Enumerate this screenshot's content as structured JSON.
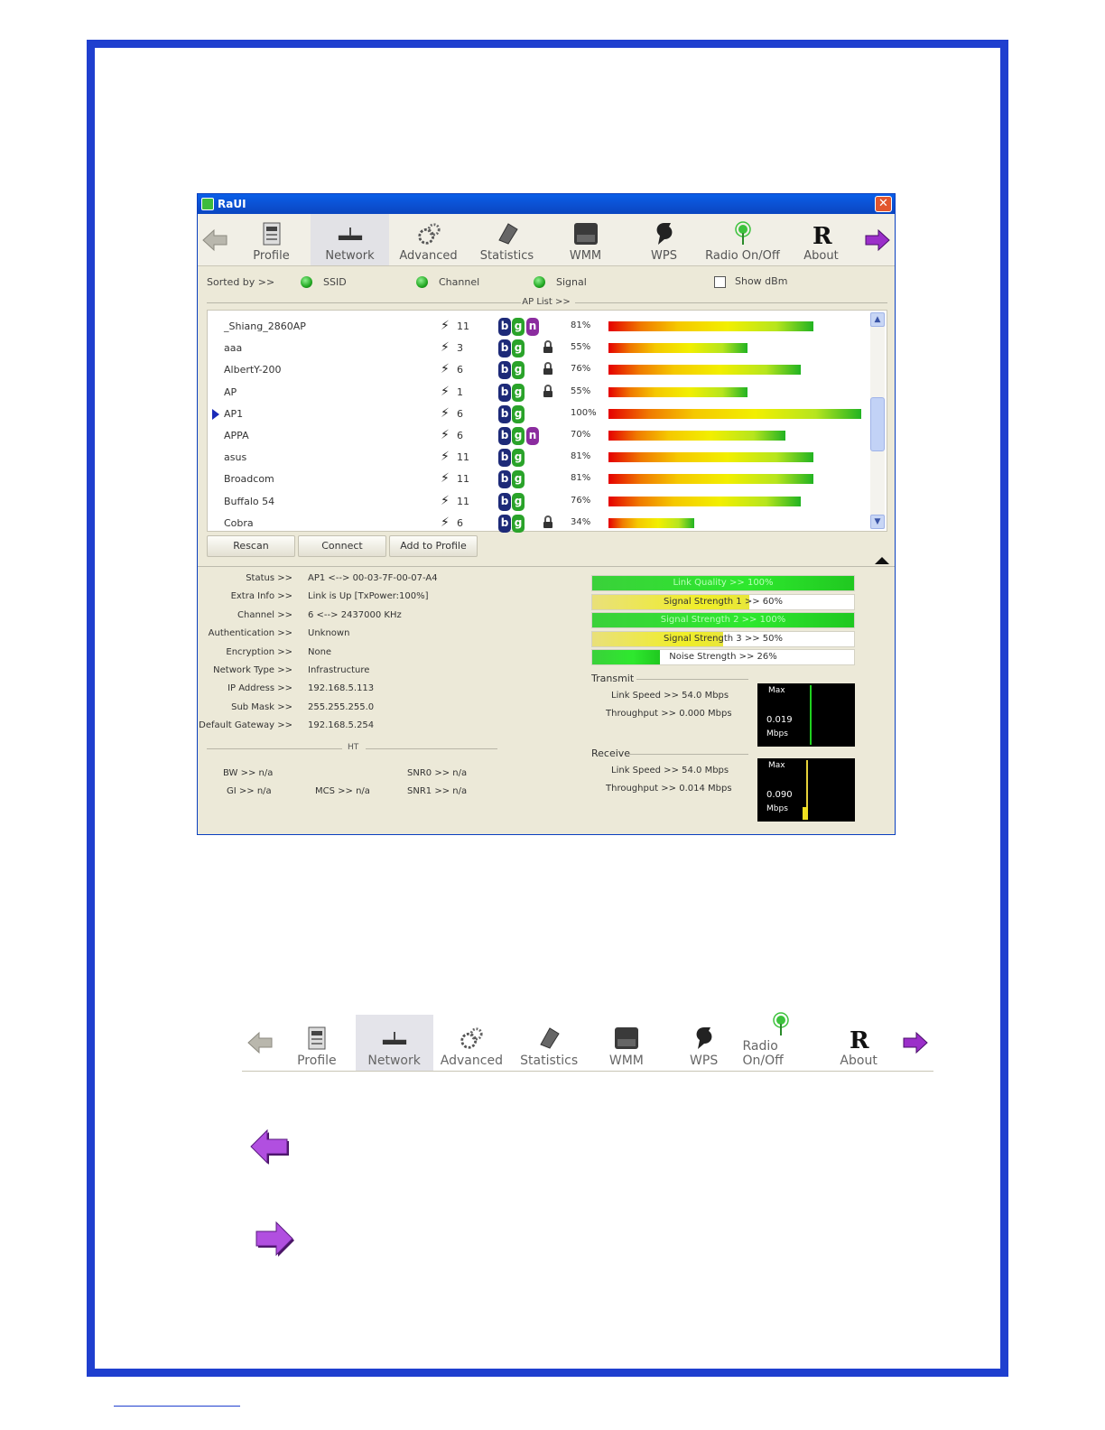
{
  "window": {
    "title": "RaUI",
    "close_glyph": "✕"
  },
  "toolbar": {
    "items": [
      {
        "label": "Profile",
        "icon": "profile-icon"
      },
      {
        "label": "Network",
        "icon": "network-icon",
        "active": true
      },
      {
        "label": "Advanced",
        "icon": "advanced-icon"
      },
      {
        "label": "Statistics",
        "icon": "statistics-icon"
      },
      {
        "label": "WMM",
        "icon": "wmm-icon"
      },
      {
        "label": "WPS",
        "icon": "wps-icon"
      },
      {
        "label": "Radio On/Off",
        "icon": "radio-icon"
      },
      {
        "label": "About",
        "icon": "about-icon"
      }
    ]
  },
  "sort": {
    "label": "Sorted by >>",
    "options": [
      "SSID",
      "Channel",
      "Signal"
    ],
    "show_dbm": "Show dBm",
    "ap_list_label": "AP List >>"
  },
  "ap_list": [
    {
      "ssid": "_Shiang_2860AP",
      "channel": "11",
      "modes": [
        "b",
        "g",
        "n"
      ],
      "locked": false,
      "signal": "81%",
      "level": 81
    },
    {
      "ssid": "aaa",
      "channel": "3",
      "modes": [
        "b",
        "g"
      ],
      "locked": true,
      "signal": "55%",
      "level": 55
    },
    {
      "ssid": "AlbertY-200",
      "channel": "6",
      "modes": [
        "b",
        "g"
      ],
      "locked": true,
      "signal": "76%",
      "level": 76
    },
    {
      "ssid": "AP",
      "channel": "1",
      "modes": [
        "b",
        "g"
      ],
      "locked": true,
      "signal": "55%",
      "level": 55
    },
    {
      "ssid": "AP1",
      "channel": "6",
      "modes": [
        "b",
        "g"
      ],
      "locked": false,
      "signal": "100%",
      "level": 100,
      "selected": true
    },
    {
      "ssid": "APPA",
      "channel": "6",
      "modes": [
        "b",
        "g",
        "n"
      ],
      "locked": false,
      "signal": "70%",
      "level": 70
    },
    {
      "ssid": "asus",
      "channel": "11",
      "modes": [
        "b",
        "g"
      ],
      "locked": false,
      "signal": "81%",
      "level": 81
    },
    {
      "ssid": "Broadcom",
      "channel": "11",
      "modes": [
        "b",
        "g"
      ],
      "locked": false,
      "signal": "81%",
      "level": 81
    },
    {
      "ssid": "Buffalo 54",
      "channel": "11",
      "modes": [
        "b",
        "g"
      ],
      "locked": false,
      "signal": "76%",
      "level": 76
    },
    {
      "ssid": "Cobra",
      "channel": "6",
      "modes": [
        "b",
        "g"
      ],
      "locked": true,
      "signal": "34%",
      "level": 34
    }
  ],
  "buttons": {
    "rescan": "Rescan",
    "connect": "Connect",
    "add_to_profile": "Add to Profile"
  },
  "status": [
    {
      "k": "Status >>",
      "v": "AP1 <--> 00-03-7F-00-07-A4"
    },
    {
      "k": "Extra Info >>",
      "v": "Link is Up [TxPower:100%]"
    },
    {
      "k": "Channel >>",
      "v": "6 <--> 2437000 KHz"
    },
    {
      "k": "Authentication >>",
      "v": "Unknown"
    },
    {
      "k": "Encryption >>",
      "v": "None"
    },
    {
      "k": "Network Type >>",
      "v": "Infrastructure"
    },
    {
      "k": "IP Address >>",
      "v": "192.168.5.113"
    },
    {
      "k": "Sub Mask >>",
      "v": "255.255.255.0"
    },
    {
      "k": "Default Gateway >>",
      "v": "192.168.5.254"
    }
  ],
  "ht": {
    "label": "HT",
    "bw": "BW >> n/a",
    "gi": "GI >> n/a",
    "mcs": "MCS >> n/a",
    "snr0": "SNR0 >> n/a",
    "snr1": "SNR1 >> n/a"
  },
  "meters": [
    {
      "label": "Link Quality >> 100%",
      "level": 100,
      "color": "green"
    },
    {
      "label": "Signal Strength 1 >> 60%",
      "level": 60,
      "color": "yellow"
    },
    {
      "label": "Signal Strength 2 >> 100%",
      "level": 100,
      "color": "green"
    },
    {
      "label": "Signal Strength 3 >> 50%",
      "level": 50,
      "color": "yellow"
    },
    {
      "label": "Noise Strength >> 26%",
      "level": 26,
      "color": "green"
    }
  ],
  "transmit": {
    "label": "Transmit",
    "link_speed": "Link Speed >> 54.0 Mbps",
    "throughput": "Throughput >> 0.000 Mbps",
    "graph_max": "Max",
    "graph_value": "0.019",
    "graph_unit": "Mbps"
  },
  "receive": {
    "label": "Receive",
    "link_speed": "Link Speed >> 54.0 Mbps",
    "throughput": "Throughput >> 0.014 Mbps",
    "graph_max": "Max",
    "graph_value": "0.090",
    "graph_unit": "Mbps"
  },
  "colors": {
    "frame": "#1f3fcf",
    "titlebar": "#0a5fe8",
    "window_bg": "#ece9d8",
    "arrow_purple": "#9b2fc9"
  }
}
